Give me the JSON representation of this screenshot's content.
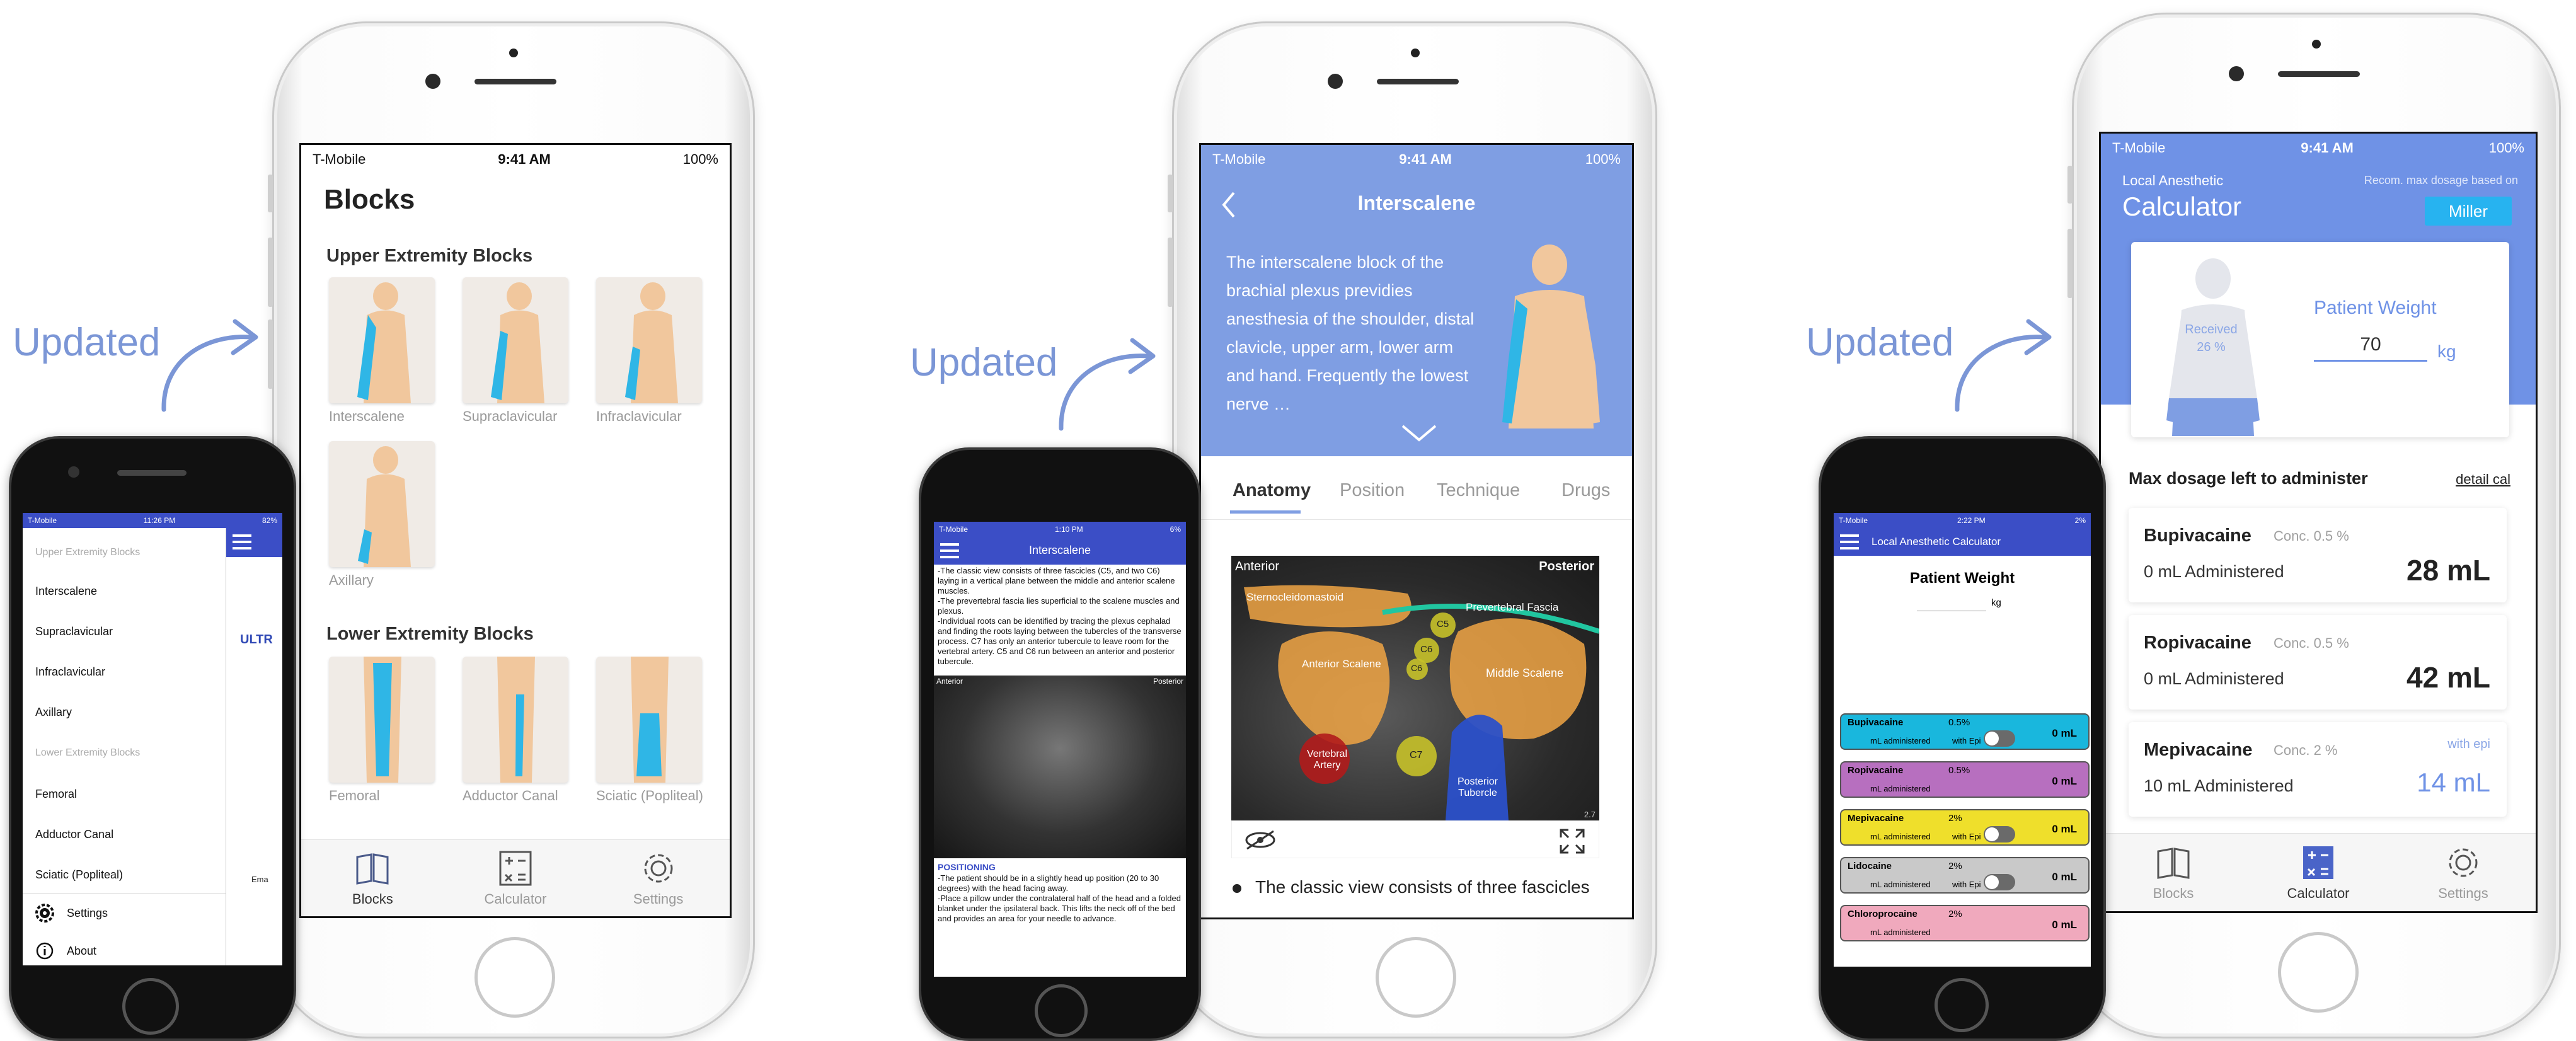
{
  "annotations": {
    "updated_label": "Updated"
  },
  "phone1_old": {
    "status": {
      "carrier": "T-Mobile",
      "time": "11:26 PM",
      "battery": "82%"
    },
    "section_upper": "Upper Extremity Blocks",
    "upper_items": [
      "Interscalene",
      "Supraclavicular",
      "Infraclavicular",
      "Axillary"
    ],
    "section_lower": "Lower Extremity Blocks",
    "lower_items": [
      "Femoral",
      "Adductor Canal",
      "Sciatic (Popliteal)"
    ],
    "settings_label": "Settings",
    "about_label": "About",
    "peek_text": "ULTR",
    "peek_text2": "Ema"
  },
  "phone1_new": {
    "status": {
      "carrier": "T-Mobile",
      "time": "9:41 AM",
      "battery": "100%"
    },
    "title": "Blocks",
    "section_upper": "Upper Extremity Blocks",
    "upper_items": [
      "Interscalene",
      "Supraclavicular",
      "Infraclavicular",
      "Axillary"
    ],
    "section_lower": "Lower Extremity Blocks",
    "lower_items": [
      "Femoral",
      "Adductor Canal",
      "Sciatic (Popliteal)"
    ],
    "tabs": [
      "Blocks",
      "Calculator",
      "Settings"
    ]
  },
  "phone2_old": {
    "status": {
      "carrier": "T-Mobile",
      "time": "1:10 PM",
      "battery": "6%"
    },
    "title": "Interscalene",
    "text_top": "-The classic view consists of three fascicles (C5, and two C6) laying in a vertical plane between the middle and anterior scalene muscles.\n-The prevertebral fascia lies superficial to the scalene muscles and plexus.\n-Individual roots can be identified by tracing the plexus cephalad and finding the roots laying between the tubercles of the transverse process. C7 has only an anterior tubercule to leave room for the vertebral artery. C5 and C6 run between an anterior and posterior tubercule.",
    "us_left": "Anterior",
    "us_right": "Posterior",
    "positioning_head": "POSITIONING",
    "positioning_text": "-The patient should be in a slightly head up position (20 to 30 degrees) with the head facing away.\n-Place a pillow under the contralateral half of the head and a folded blanket under the ipsilateral back. This lifts the neck off of the bed and provides an area for your needle to advance."
  },
  "phone2_new": {
    "status": {
      "carrier": "T-Mobile",
      "time": "9:41 AM",
      "battery": "100%"
    },
    "title": "Interscalene",
    "description": "The interscalene block of the brachial plexus previdies anesthesia of the shoulder, distal clavicle, upper arm, lower arm and hand. Frequently the lowest nerve …",
    "segments": [
      "Anatomy",
      "Position",
      "Technique",
      "Drugs"
    ],
    "us_labels": {
      "anterior": "Anterior",
      "posterior": "Posterior",
      "scm": "Sternocleidomastoid",
      "prevertebral": "Prevertebral Fascia",
      "ant_scalene": "Anterior Scalene",
      "mid_scalene": "Middle Scalene",
      "c5": "C5",
      "c6a": "C6",
      "c6b": "C6",
      "c7": "C7",
      "vert_artery": "Vertebral Artery",
      "post_tubercle": "Posterior Tubercle",
      "depth": "2.7"
    },
    "bullet": "The classic view consists of three fascicles"
  },
  "phone3_old": {
    "status": {
      "carrier": "T-Mobile",
      "time": "2:22 PM",
      "battery": "2%"
    },
    "title": "Local Anesthetic Calculator",
    "patient_weight": "Patient Weight",
    "unit": "kg",
    "drugs": [
      {
        "name": "Bupivacaine",
        "conc": "0.5%",
        "administered": "mL administered",
        "epi": "with Epi",
        "value": "0 mL",
        "color": "#19b7dd",
        "toggle": true
      },
      {
        "name": "Ropivacaine",
        "conc": "0.5%",
        "administered": "mL administered",
        "epi": "",
        "value": "0 mL",
        "color": "#b76fbf",
        "toggle": false
      },
      {
        "name": "Mepivacaine",
        "conc": "2%",
        "administered": "mL administered",
        "epi": "with Epi",
        "value": "0 mL",
        "color": "#efdf2b",
        "toggle": true
      },
      {
        "name": "Lidocaine",
        "conc": "2%",
        "administered": "mL administered",
        "epi": "with Epi",
        "value": "0 mL",
        "color": "#c9c9c9",
        "toggle": true
      },
      {
        "name": "Chloroprocaine",
        "conc": "2%",
        "administered": "mL administered",
        "epi": "",
        "value": "0 mL",
        "color": "#f0a9bd",
        "toggle": false
      }
    ]
  },
  "phone3_new": {
    "status": {
      "carrier": "T-Mobile",
      "time": "9:41 AM",
      "battery": "100%"
    },
    "subtitle": "Local Anesthetic",
    "title": "Calculator",
    "recom_label": "Recom. max dosage based on",
    "recom_button": "Miller",
    "received_label": "Received",
    "received_pct": "26 %",
    "weight_label": "Patient Weight",
    "weight_value": "70",
    "weight_unit": "kg",
    "max_dosage_label": "Max dosage left to administer",
    "detail_link": "detail cal",
    "drugs": [
      {
        "name": "Bupivacaine",
        "conc": "Conc. 0.5 %",
        "administered": "0 mL Administered",
        "value": "28 mL",
        "epi": ""
      },
      {
        "name": "Ropivacaine",
        "conc": "Conc. 0.5 %",
        "administered": "0 mL Administered",
        "value": "42 mL",
        "epi": ""
      },
      {
        "name": "Mepivacaine",
        "conc": "Conc. 2 %",
        "administered": "10 mL Administered",
        "value": "14 mL",
        "epi": "with epi"
      }
    ],
    "tabs": [
      "Blocks",
      "Calculator",
      "Settings"
    ]
  }
}
